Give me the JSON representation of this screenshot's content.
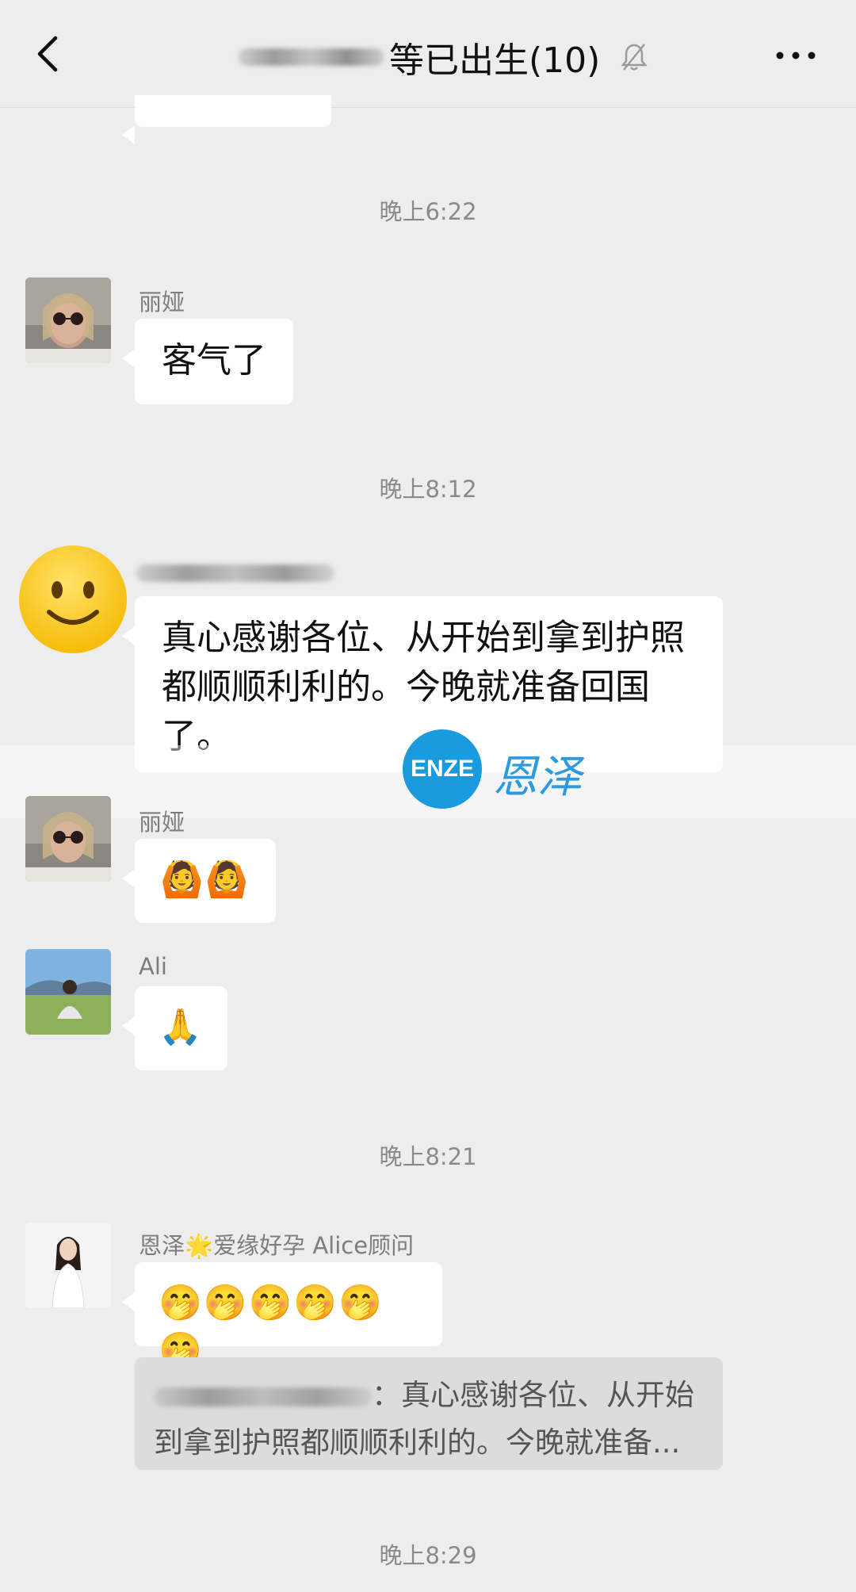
{
  "header": {
    "title": "等已出生(10)",
    "back_icon": "back-arrow",
    "mute_icon": "bell-muted",
    "more_icon": "more-dots"
  },
  "timestamps": [
    "晚上6:22",
    "晚上8:12",
    "晚上8:21",
    "晚上8:29"
  ],
  "messages": [
    {
      "sender": "丽娅",
      "text": "客气了"
    },
    {
      "sender": "",
      "text": "真心感谢各位、从开始到拿到护照都顺顺利利的。今晚就准备回国了。",
      "line1": "真心感谢各位、从开始到拿到护照",
      "line2": "都顺顺利利的。今晚就准备回国",
      "line3": "了。"
    },
    {
      "sender": "丽娅",
      "text": "🙆🙆"
    },
    {
      "sender": "Ali",
      "text": "🙏"
    },
    {
      "sender": "恩泽🌟爱缘好孕 Alice顾问",
      "text": "🤭🤭🤭🤭🤭🤭"
    }
  ],
  "quote": {
    "line1": "：真心感谢各位、从开始",
    "line2": "到拿到护照都顺顺利利的。今晚就准备..."
  },
  "watermark": {
    "logo_text": "ENZE",
    "cn_text": "恩泽"
  }
}
